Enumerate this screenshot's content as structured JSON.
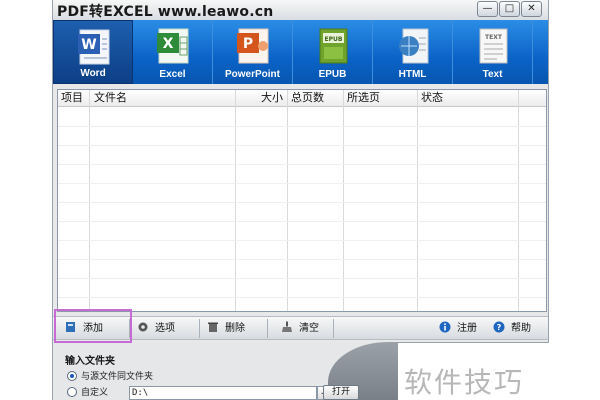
{
  "window": {
    "title": "PDF转EXCEL www.leawo.cn",
    "controls": [
      "—",
      "□",
      "✕"
    ]
  },
  "toolbar": {
    "buttons": [
      {
        "label": "Word",
        "icon": "word-doc-icon",
        "color": "#2b5fb4",
        "active": true
      },
      {
        "label": "Excel",
        "icon": "excel-doc-icon",
        "color": "#2e8b3a",
        "active": false
      },
      {
        "label": "PowerPoint",
        "icon": "powerpoint-doc-icon",
        "color": "#d4561c",
        "active": false
      },
      {
        "label": "EPUB",
        "icon": "epub-doc-icon",
        "color": "#6fa32b",
        "active": false
      },
      {
        "label": "HTML",
        "icon": "html-doc-icon",
        "color": "#3a7fc1",
        "active": false
      },
      {
        "label": "Text",
        "icon": "text-doc-icon",
        "color": "#8a8a8a",
        "active": false
      }
    ]
  },
  "grid": {
    "columns": [
      "项目",
      "文件名",
      "大小",
      "总页数",
      "所选页",
      "状态"
    ],
    "rows": []
  },
  "actions": {
    "add": "添加",
    "options": "选项",
    "delete": "删除",
    "clear": "清空",
    "register": "注册",
    "help": "帮助"
  },
  "output": {
    "label": "输入文件夹",
    "same_folder": "与源文件同文件夹",
    "custom": "自定义",
    "path": "D:\\",
    "browse": "...",
    "open": "打开"
  },
  "watermark": "软件技巧",
  "colors": {
    "toolbar_top": "#2b8de6",
    "toolbar_bottom": "#0756b0",
    "highlight": "#c66bd3"
  }
}
